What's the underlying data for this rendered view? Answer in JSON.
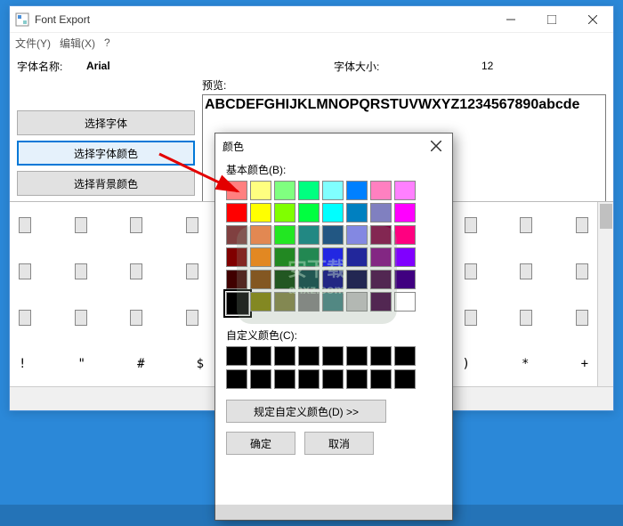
{
  "window": {
    "title": "Font Export",
    "menu": {
      "file": "文件(Y)",
      "edit": "编辑(X)",
      "help": "?"
    }
  },
  "labels": {
    "fontName": "字体名称:",
    "fontSize": "字体大小:",
    "preview": "预览:",
    "selectFont": "选择字体",
    "selectFontColor": "选择字体颜色",
    "selectBgColor": "选择背景颜色",
    "ellipsis": "..."
  },
  "values": {
    "fontName": "Arial",
    "fontSize": "12",
    "previewText": "ABCDEFGHIJKLMNOPQRSTUVWXYZ1234567890abcde"
  },
  "glyphs": {
    "row4": [
      "!",
      "\"",
      "#",
      "$",
      "",
      "",
      "",
      "",
      ")",
      "*",
      "+"
    ]
  },
  "colorDialog": {
    "title": "颜色",
    "basicLabel": "基本颜色(B):",
    "customLabel": "自定义颜色(C):",
    "defineBtn": "规定自定义颜色(D) >>",
    "ok": "确定",
    "cancel": "取消",
    "basicColors": [
      [
        "#FF8080",
        "#FFFF80",
        "#80FF80",
        "#00FF80",
        "#80FFFF",
        "#0080FF",
        "#FF80C0",
        "#FF80FF"
      ],
      [
        "#FF0000",
        "#FFFF00",
        "#80FF00",
        "#00FF40",
        "#00FFFF",
        "#0080C0",
        "#8080C0",
        "#FF00FF"
      ],
      [
        "#804040",
        "#FF8040",
        "#00FF00",
        "#008080",
        "#004080",
        "#8080FF",
        "#800040",
        "#FF0080"
      ],
      [
        "#800000",
        "#FF8000",
        "#008000",
        "#008040",
        "#0000FF",
        "#0000A0",
        "#800080",
        "#8000FF"
      ],
      [
        "#400000",
        "#804000",
        "#004000",
        "#004040",
        "#000080",
        "#000040",
        "#400040",
        "#400080"
      ],
      [
        "#000000",
        "#808000",
        "#808040",
        "#808080",
        "#408080",
        "#C0C0C0",
        "#400040",
        "#FFFFFF"
      ]
    ],
    "customColors": [
      [
        "#000000",
        "#000000",
        "#000000",
        "#000000",
        "#000000",
        "#000000",
        "#000000",
        "#000000"
      ],
      [
        "#000000",
        "#000000",
        "#000000",
        "#000000",
        "#000000",
        "#000000",
        "#000000",
        "#000000"
      ]
    ],
    "selectedIndex": [
      5,
      0
    ]
  }
}
